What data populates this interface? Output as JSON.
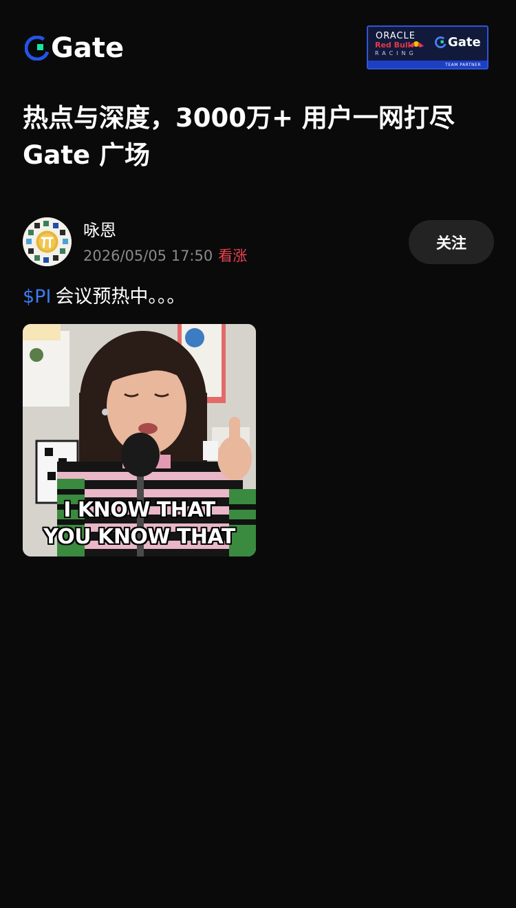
{
  "header": {
    "logo_text": "Gate",
    "partner_badge": {
      "brand_oracle": "ORACLE",
      "brand_redbull": "Red Bull",
      "brand_racing": "RACING",
      "brand_gate": "Gate",
      "caption": "TEAM PARTNER"
    }
  },
  "headline": "热点与深度，3000万+ 用户一网打尽 Gate 广场",
  "post": {
    "author": "咏恩",
    "timestamp": "2026/05/05 17:50",
    "sentiment": "看涨",
    "follow_label": "关注",
    "ticker": "$PI",
    "body": "会议预热中。。。",
    "media": {
      "caption_line1": "I KNOW THAT",
      "caption_line2": "YOU KNOW THAT"
    }
  },
  "colors": {
    "background": "#0a0a0b",
    "accent_blue": "#3d7bf0",
    "bullish_red": "#e8424f",
    "muted_text": "#8a8a8e",
    "button_bg": "#232324",
    "gate_blue": "#2354e6",
    "gate_green": "#17e5a0"
  },
  "icons": {
    "logo": "gate-logo-icon",
    "avatar": "pi-network-avatar-icon"
  }
}
